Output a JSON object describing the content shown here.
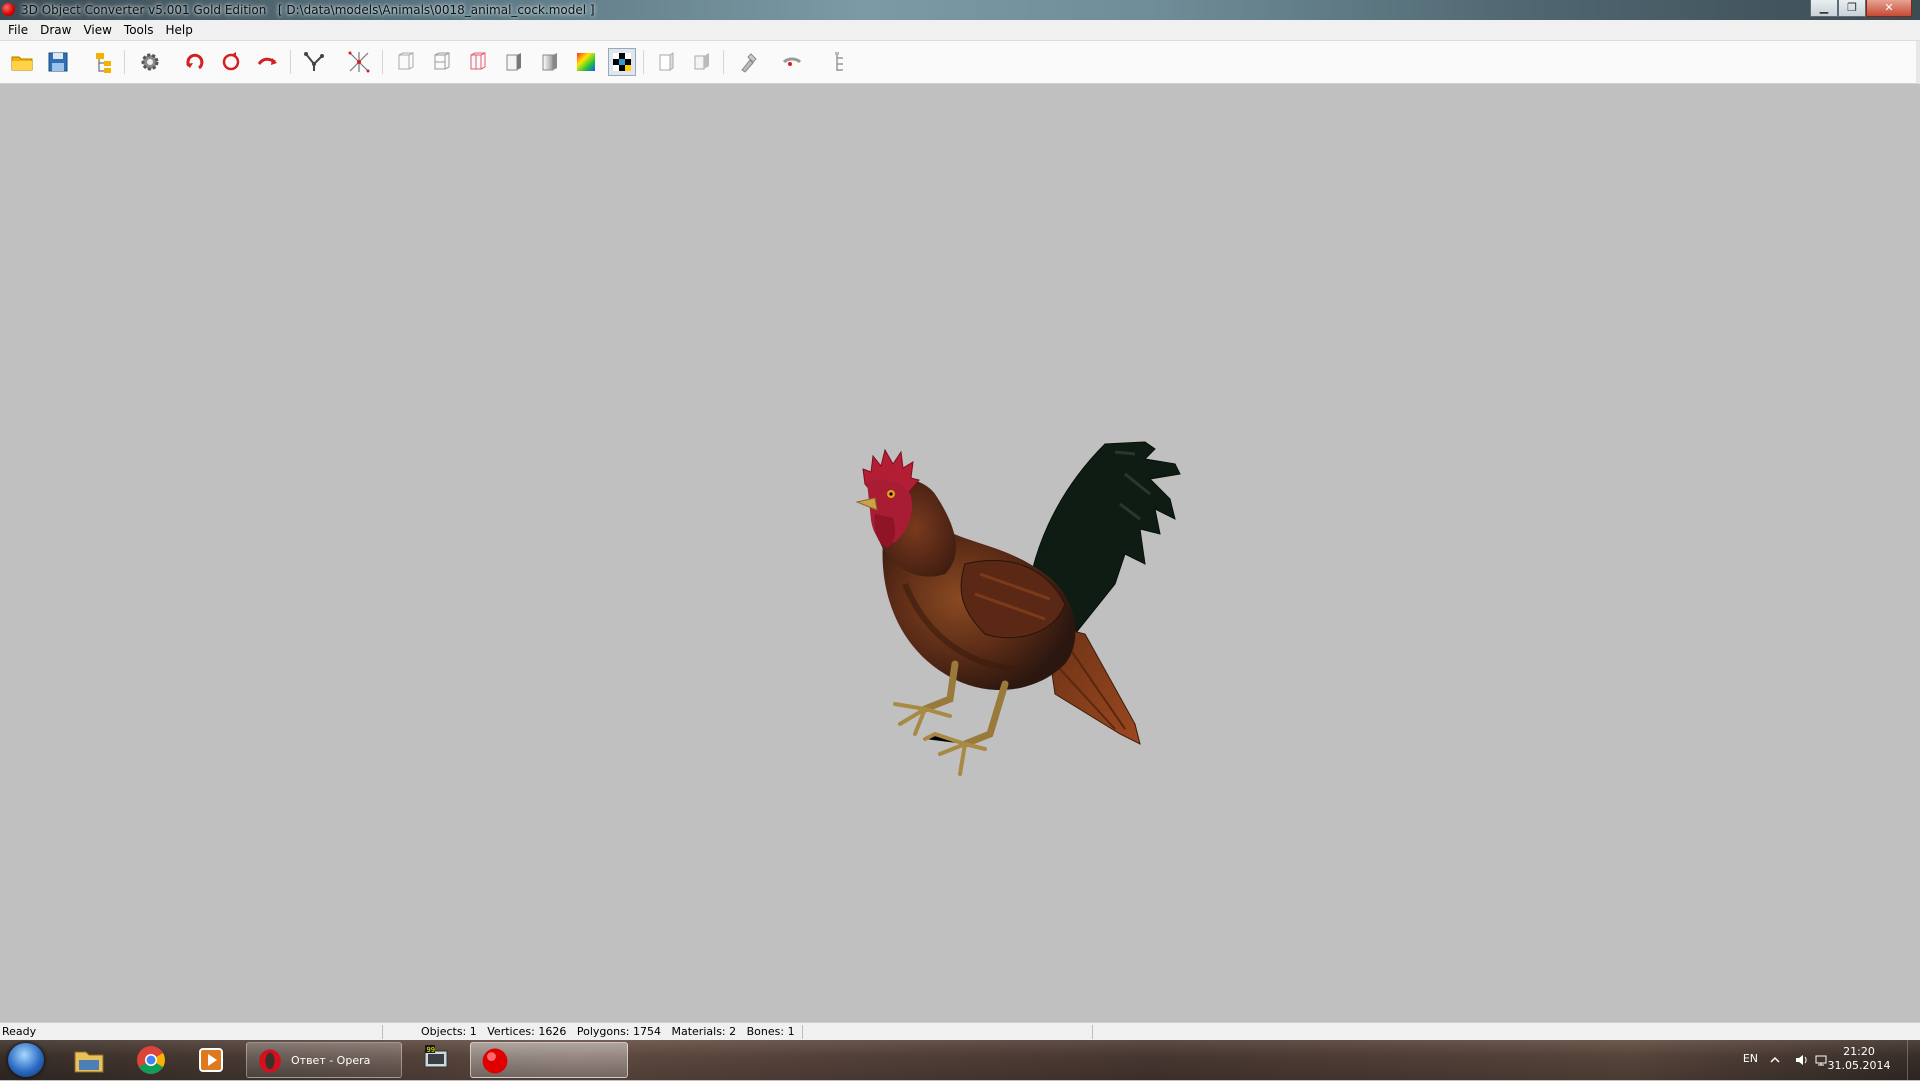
{
  "window": {
    "title": "3D Object Converter v5.001 Gold Edition",
    "document_path": "[ D:\\data\\models\\Animals\\0018_animal_cock.model ]",
    "controls": [
      "minimize",
      "maximize",
      "close"
    ]
  },
  "menu": {
    "items": [
      {
        "label": "File"
      },
      {
        "label": "Draw"
      },
      {
        "label": "View"
      },
      {
        "label": "Tools"
      },
      {
        "label": "Help"
      }
    ]
  },
  "toolbar": {
    "buttons": [
      {
        "icon": "open-folder-icon"
      },
      {
        "icon": "save-disk-icon"
      },
      {
        "icon": "object-tree-icon"
      },
      {
        "icon": "settings-gear-icon"
      },
      {
        "icon": "rotate-x-icon"
      },
      {
        "icon": "rotate-y-icon"
      },
      {
        "icon": "rotate-z-icon"
      },
      {
        "icon": "bones-icon"
      },
      {
        "icon": "vertices-icon"
      },
      {
        "icon": "wireframe-front-icon"
      },
      {
        "icon": "wireframe-side-icon"
      },
      {
        "icon": "wireframe-red-icon"
      },
      {
        "icon": "flat-shade-icon"
      },
      {
        "icon": "smooth-shade-icon"
      },
      {
        "icon": "color-shade-icon"
      },
      {
        "icon": "texture-shade-icon",
        "active": true
      },
      {
        "icon": "normals-icon"
      },
      {
        "icon": "backface-icon"
      },
      {
        "icon": "light-icon"
      },
      {
        "icon": "camera-icon"
      },
      {
        "icon": "hierarchy-icon"
      }
    ]
  },
  "viewport": {
    "background": "#c0c0c0",
    "model": "rooster"
  },
  "status": {
    "ready": "Ready",
    "objects": "Objects: 1",
    "vertices": "Vertices: 1626",
    "polygons": "Polygons: 1754",
    "materials": "Materials: 2",
    "bones": "Bones: 1"
  },
  "taskbar": {
    "opera_label": "Ответ - Opera",
    "language": "EN",
    "time": "21:20",
    "date": "31.05.2014"
  }
}
